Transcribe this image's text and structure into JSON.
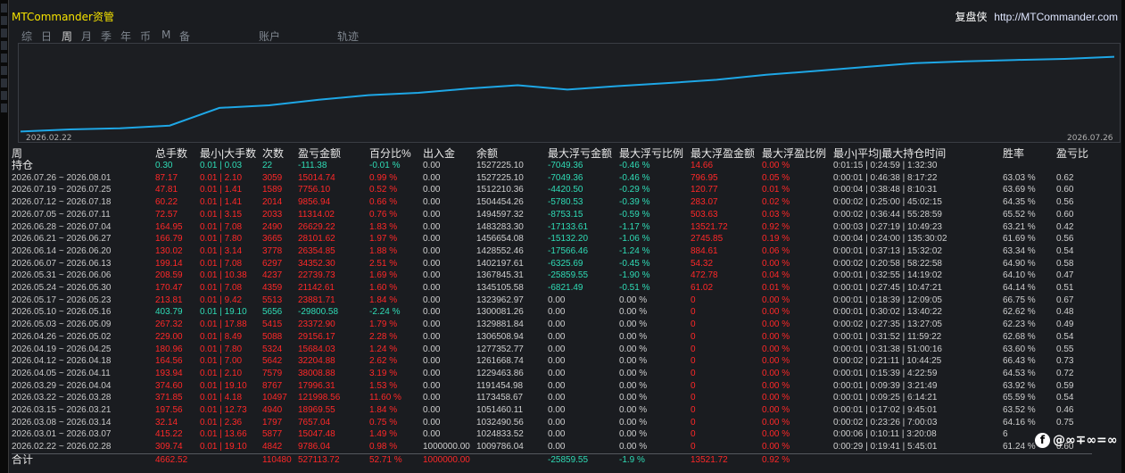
{
  "window": {
    "title": "MTCommander资管",
    "brand_name": "复盘侠",
    "brand_url": "http://MTCommander.com"
  },
  "tabs": [
    "综",
    "日",
    "周",
    "月",
    "季",
    "年",
    "币",
    "M",
    "备",
    "账户",
    "轨迹"
  ],
  "active_tab": "周",
  "chart": {
    "start_date": "2026.02.22",
    "end_date": "2026.07.26",
    "line_color": "#1ea7e6"
  },
  "chart_data": {
    "type": "line",
    "x": [
      "2026.02.22",
      "2026.03.01",
      "2026.03.08",
      "2026.03.15",
      "2026.03.22",
      "2026.03.29",
      "2026.04.05",
      "2026.04.12",
      "2026.04.19",
      "2026.04.26",
      "2026.05.03",
      "2026.05.10",
      "2026.05.17",
      "2026.05.24",
      "2026.05.31",
      "2026.06.07",
      "2026.06.14",
      "2026.06.21",
      "2026.06.28",
      "2026.07.05",
      "2026.07.12",
      "2026.07.19",
      "2026.07.26"
    ],
    "y": [
      1009786.04,
      1024833.52,
      1032490.56,
      1051460.11,
      1173458.67,
      1191454.98,
      1229463.86,
      1261668.74,
      1277352.77,
      1306508.94,
      1329881.84,
      1300081.26,
      1323962.97,
      1345105.58,
      1367845.31,
      1402197.61,
      1428552.46,
      1456654.08,
      1483283.3,
      1494597.32,
      1504454.26,
      1512210.36,
      1527225.1
    ]
  },
  "table": {
    "headers": [
      "周",
      "总手数",
      "最小|大手数",
      "次数",
      "盈亏金额",
      "百分比%",
      "出入金",
      "余额",
      "最大浮亏金额",
      "最大浮亏比例",
      "最大浮盈金额",
      "最大浮盈比例",
      "最小|平均|最大持仓时间",
      "胜率",
      "盈亏比"
    ],
    "hold_row": [
      "持仓",
      "0.30",
      "0.01 | 0.03",
      "22",
      "-111.38",
      "-0.01 %",
      "0.00",
      "1527225.10",
      "-7049.36",
      "-0.46 %",
      "14.66",
      "0.00 %",
      "0:01:15 | 0:24:59 | 1:32:30",
      "",
      ""
    ],
    "rows": [
      [
        "2026.07.26 ~ 2026.08.01",
        "87.17",
        "0.01 | 2.10",
        "3059",
        "15014.74",
        "0.99 %",
        "0.00",
        "1527225.10",
        "-7049.36",
        "-0.46 %",
        "796.95",
        "0.05 %",
        "0:00:01 | 0:46:38 | 8:17:22",
        "63.03 %",
        "0.62"
      ],
      [
        "2026.07.19 ~ 2026.07.25",
        "47.81",
        "0.01 | 1.41",
        "1589",
        "7756.10",
        "0.52 %",
        "0.00",
        "1512210.36",
        "-4420.50",
        "-0.29 %",
        "120.77",
        "0.01 %",
        "0:00:04 | 0:38:48 | 8:10:31",
        "63.69 %",
        "0.60"
      ],
      [
        "2026.07.12 ~ 2026.07.18",
        "60.22",
        "0.01 | 1.41",
        "2014",
        "9856.94",
        "0.66 %",
        "0.00",
        "1504454.26",
        "-5780.53",
        "-0.39 %",
        "283.07",
        "0.02 %",
        "0:00:02 | 0:25:00 | 45:02:15",
        "64.35 %",
        "0.56"
      ],
      [
        "2026.07.05 ~ 2026.07.11",
        "72.57",
        "0.01 | 3.15",
        "2033",
        "11314.02",
        "0.76 %",
        "0.00",
        "1494597.32",
        "-8753.15",
        "-0.59 %",
        "503.63",
        "0.03 %",
        "0:00:02 | 0:36:44 | 55:28:59",
        "65.52 %",
        "0.60"
      ],
      [
        "2026.06.28 ~ 2026.07.04",
        "164.95",
        "0.01 | 7.08",
        "2490",
        "26629.22",
        "1.83 %",
        "0.00",
        "1483283.30",
        "-17133.61",
        "-1.17 %",
        "13521.72",
        "0.92 %",
        "0:00:03 | 0:27:19 | 10:49:23",
        "63.21 %",
        "0.42"
      ],
      [
        "2026.06.21 ~ 2026.06.27",
        "166.79",
        "0.01 | 7.80",
        "3665",
        "28101.62",
        "1.97 %",
        "0.00",
        "1456654.08",
        "-15132.20",
        "-1.06 %",
        "2745.85",
        "0.19 %",
        "0:00:04 | 0:24:00 | 135:30:02",
        "61.69 %",
        "0.56"
      ],
      [
        "2026.06.14 ~ 2026.06.20",
        "130.02",
        "0.01 | 3.14",
        "3778",
        "26354.85",
        "1.88 %",
        "0.00",
        "1428552.46",
        "-17566.46",
        "-1.24 %",
        "884.61",
        "0.06 %",
        "0:00:01 | 0:37:13 | 15:32:02",
        "63.34 %",
        "0.54"
      ],
      [
        "2026.06.07 ~ 2026.06.13",
        "199.14",
        "0.01 | 7.08",
        "6297",
        "34352.30",
        "2.51 %",
        "0.00",
        "1402197.61",
        "-6325.69",
        "-0.45 %",
        "54.32",
        "0.00 %",
        "0:00:02 | 0:20:58 | 58:22:58",
        "64.90 %",
        "0.58"
      ],
      [
        "2026.05.31 ~ 2026.06.06",
        "208.59",
        "0.01 | 10.38",
        "4237",
        "22739.73",
        "1.69 %",
        "0.00",
        "1367845.31",
        "-25859.55",
        "-1.90 %",
        "472.78",
        "0.04 %",
        "0:00:01 | 0:32:55 | 14:19:02",
        "64.10 %",
        "0.47"
      ],
      [
        "2026.05.24 ~ 2026.05.30",
        "170.47",
        "0.01 | 7.08",
        "4359",
        "21142.61",
        "1.60 %",
        "0.00",
        "1345105.58",
        "-6821.49",
        "-0.51 %",
        "61.02",
        "0.01 %",
        "0:00:01 | 0:27:45 | 10:47:21",
        "64.14 %",
        "0.51"
      ],
      [
        "2026.05.17 ~ 2026.05.23",
        "213.81",
        "0.01 | 9.42",
        "5513",
        "23881.71",
        "1.84 %",
        "0.00",
        "1323962.97",
        "0.00",
        "0.00 %",
        "0",
        "0.00 %",
        "0:00:01 | 0:18:39 | 12:09:05",
        "66.75 %",
        "0.67"
      ],
      [
        "2026.05.10 ~ 2026.05.16",
        "403.79",
        "0.01 | 19.10",
        "5656",
        "-29800.58",
        "-2.24 %",
        "0.00",
        "1300081.26",
        "0.00",
        "0.00 %",
        "0",
        "0.00 %",
        "0:00:01 | 0:30:02 | 13:40:22",
        "62.62 %",
        "0.48"
      ],
      [
        "2026.05.03 ~ 2026.05.09",
        "267.32",
        "0.01 | 17.88",
        "5415",
        "23372.90",
        "1.79 %",
        "0.00",
        "1329881.84",
        "0.00",
        "0.00 %",
        "0",
        "0.00 %",
        "0:00:02 | 0:27:35 | 13:27:05",
        "62.23 %",
        "0.49"
      ],
      [
        "2026.04.26 ~ 2026.05.02",
        "229.00",
        "0.01 | 8.49",
        "5088",
        "29156.17",
        "2.28 %",
        "0.00",
        "1306508.94",
        "0.00",
        "0.00 %",
        "0",
        "0.00 %",
        "0:00:01 | 0:31:52 | 11:59:22",
        "62.68 %",
        "0.54"
      ],
      [
        "2026.04.19 ~ 2026.04.25",
        "180.96",
        "0.01 | 7.80",
        "5324",
        "15684.03",
        "1.24 %",
        "0.00",
        "1277352.77",
        "0.00",
        "0.00 %",
        "0",
        "0.00 %",
        "0:00:01 | 0:31:38 | 51:00:16",
        "63.60 %",
        "0.55"
      ],
      [
        "2026.04.12 ~ 2026.04.18",
        "164.56",
        "0.01 | 7.00",
        "5642",
        "32204.88",
        "2.62 %",
        "0.00",
        "1261668.74",
        "0.00",
        "0.00 %",
        "0",
        "0.00 %",
        "0:00:02 | 0:21:11 | 10:44:25",
        "66.43 %",
        "0.73"
      ],
      [
        "2026.04.05 ~ 2026.04.11",
        "193.94",
        "0.01 | 2.10",
        "7579",
        "38008.88",
        "3.19 %",
        "0.00",
        "1229463.86",
        "0.00",
        "0.00 %",
        "0",
        "0.00 %",
        "0:00:01 | 0:15:39 | 4:22:59",
        "64.53 %",
        "0.72"
      ],
      [
        "2026.03.29 ~ 2026.04.04",
        "374.60",
        "0.01 | 19.10",
        "8767",
        "17996.31",
        "1.53 %",
        "0.00",
        "1191454.98",
        "0.00",
        "0.00 %",
        "0",
        "0.00 %",
        "0:00:01 | 0:09:39 | 3:21:49",
        "63.92 %",
        "0.59"
      ],
      [
        "2026.03.22 ~ 2026.03.28",
        "371.85",
        "0.01 | 4.18",
        "10497",
        "121998.56",
        "11.60 %",
        "0.00",
        "1173458.67",
        "0.00",
        "0.00 %",
        "0",
        "0.00 %",
        "0:00:01 | 0:09:25 | 6:14:21",
        "65.59 %",
        "0.54"
      ],
      [
        "2026.03.15 ~ 2026.03.21",
        "197.56",
        "0.01 | 12.73",
        "4940",
        "18969.55",
        "1.84 %",
        "0.00",
        "1051460.11",
        "0.00",
        "0.00 %",
        "0",
        "0.00 %",
        "0:00:01 | 0:17:02 | 9:45:01",
        "63.52 %",
        "0.46"
      ],
      [
        "2026.03.08 ~ 2026.03.14",
        "32.14",
        "0.01 | 2.36",
        "1797",
        "7657.04",
        "0.75 %",
        "0.00",
        "1032490.56",
        "0.00",
        "0.00 %",
        "0",
        "0.00 %",
        "0:00:02 | 0:23:26 | 7:00:03",
        "64.16 %",
        "0.75"
      ],
      [
        "2026.03.01 ~ 2026.03.07",
        "415.22",
        "0.01 | 13.66",
        "5877",
        "15047.48",
        "1.49 %",
        "0.00",
        "1024833.52",
        "0.00",
        "0.00 %",
        "0",
        "0.00 %",
        "0:00:06 | 0:10:11 | 3:20:08",
        "6",
        ""
      ],
      [
        "2026.02.22 ~ 2026.02.28",
        "309.74",
        "0.01 | 19.10",
        "4842",
        "9786.04",
        "0.98 %",
        "1000000.00",
        "1009786.04",
        "0.00",
        "0.00 %",
        "0",
        "0.00 %",
        "0:00:29 | 0:19:41 | 5:45:01",
        "61.24 %",
        "0.60"
      ]
    ],
    "total_row": [
      "合计",
      "4662.52",
      "",
      "110480",
      "527113.72",
      "52.71 %",
      "1000000.00",
      "",
      "-25859.55",
      "-1.9 %",
      "13521.72",
      "0.92 %",
      "",
      "",
      ""
    ]
  },
  "badge": {
    "icon": "facebook-icon",
    "text": "@∞∓∞=∞"
  }
}
